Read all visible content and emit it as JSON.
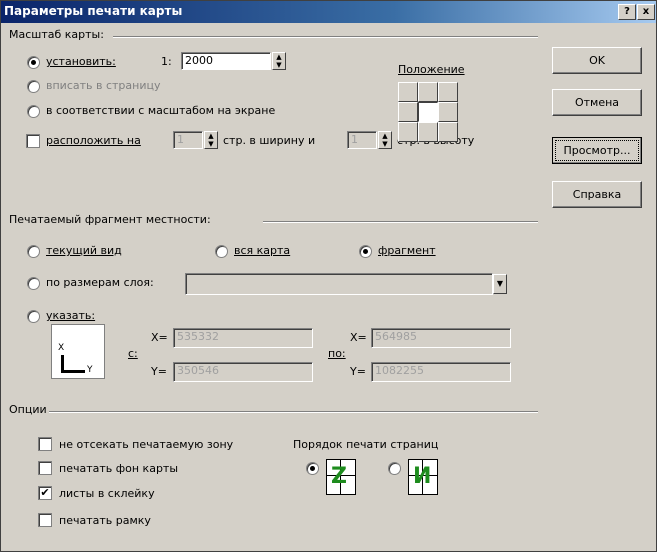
{
  "window": {
    "title": "Параметры печати карты",
    "help_btn": "?",
    "close_btn": "x"
  },
  "buttons": {
    "ok": "OK",
    "cancel": "Отмена",
    "preview": "Просмотр...",
    "help": "Справка"
  },
  "scale": {
    "group_label": "Масштаб карты:",
    "set_label": "установить:",
    "ratio_prefix": "1:",
    "ratio_value": "2000",
    "fit_label": "вписать в страницу",
    "screen_label": "в соответствии с масштабом на экране",
    "arrange_label": "расположить на",
    "pages_wide_value": "1",
    "pages_wide_suffix": "стр. в ширину и",
    "pages_high_value": "1",
    "pages_high_suffix": "стр. в высоту",
    "position_label": "Положение"
  },
  "fragment": {
    "group_label": "Печатаемый фрагмент местности:",
    "current_view": "текущий вид",
    "whole_map": "вся карта",
    "fragment": "фрагмент",
    "by_layer": "по размерам слоя:",
    "specify": "указать:",
    "from_label": "с:",
    "to_label": "по:",
    "x_label": "X=",
    "y_label": "Y=",
    "from_x": "535332",
    "from_y": "350546",
    "to_x": "564985",
    "to_y": "1082255",
    "axis_x": "X",
    "axis_y": "Y"
  },
  "options": {
    "group_label": "Опции",
    "no_clip": "не отсекать печатаемую зону",
    "print_bg": "печатать фон карты",
    "glue_sheets": "листы в склейку",
    "print_frame": "печатать рамку",
    "page_order_label": "Порядок печати страниц",
    "order_icon_1": "Z",
    "order_icon_2": "И"
  }
}
